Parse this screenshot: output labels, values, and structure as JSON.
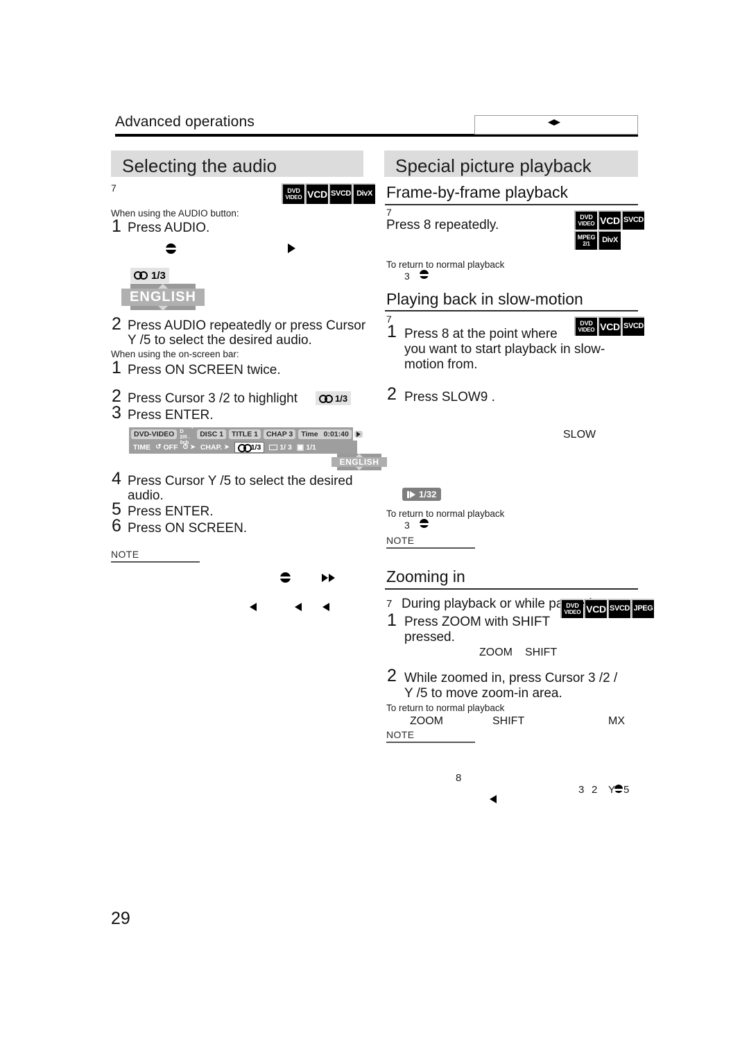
{
  "page": {
    "running_head": "Advanced operations",
    "page_number": "29",
    "header_box_icon": "diamond-marker-icon"
  },
  "left_column": {
    "section_title": "Selecting the audio",
    "format_badges": [
      {
        "line1": "DVD",
        "line2": "VIDEO"
      },
      {
        "line1": "VCD"
      },
      {
        "line1": "SVCD"
      },
      {
        "line1": "DivX"
      }
    ],
    "marker_7": "7",
    "intro_audio_button": "When using the AUDIO button:",
    "step1_num": "1",
    "step1_text": "Press AUDIO.",
    "osd": {
      "tag_value": "1/3",
      "tag_icon": "audio-channel-icon",
      "language": "ENGLISH"
    },
    "step2_num": "2",
    "step2_text_line1": "Press AUDIO repeatedly or press Cursor",
    "step2_text_line2": "Y /5  to select the desired audio.",
    "intro_onscreen_bar": "When using the on-screen bar:",
    "bar_step1_num": "1",
    "bar_step1_text": "Press ON SCREEN twice.",
    "bar_step2_num": "2",
    "bar_step2_text": "Press Cursor  3 /2  to highlight",
    "bar_step2_tag": "1/3",
    "bar_step3_num": "3",
    "bar_step3_text": "Press ENTER.",
    "onscreen_bar": {
      "disc_type": "DVD-VIDEO",
      "audio_format_line1": "Dolby D",
      "audio_format_line2": "2/0 . 0ch",
      "disc": "DISC 1",
      "title": "TITLE 1",
      "chapter": "CHAP  3",
      "time_label": "Time",
      "time_value": "0:01:40",
      "row2_time": "TIME",
      "row2_repeat": "OFF",
      "row2_clock": "",
      "row2_chap": "CHAP.",
      "row2_audio": "1/3",
      "row2_subtitle": "1/ 3",
      "row2_angle": "1/1",
      "popup_language": "ENGLISH"
    },
    "step4_num": "4",
    "step4_text_line1": "Press Cursor  Y /5  to select the desired",
    "step4_text_line2": "audio.",
    "step5_num": "5",
    "step5_text": "Press ENTER.",
    "step6_num": "6",
    "step6_text": "Press ON SCREEN.",
    "note_label": "NOTE"
  },
  "right_column": {
    "section_title": "Special picture playback",
    "frame_by_frame": {
      "heading": "Frame-by-frame playback",
      "marker_7": "7",
      "instruction": "Press  8  repeatedly.",
      "badges": [
        {
          "line1": "DVD",
          "line2": "VIDEO"
        },
        {
          "line1": "VCD"
        },
        {
          "line1": "SVCD"
        },
        {
          "line1": "MPEG",
          "line2": "2/1"
        },
        {
          "line1": "DivX"
        }
      ],
      "return_label": "To return to normal playback",
      "return_step": "3"
    },
    "slow_motion": {
      "heading": "Playing back in slow-motion",
      "marker_7": "7",
      "badges": [
        {
          "line1": "DVD",
          "line2": "VIDEO"
        },
        {
          "line1": "VCD"
        },
        {
          "line1": "SVCD"
        }
      ],
      "step1_num": "1",
      "step1_line1": "Press  8  at the point where",
      "step1_line2": "you want to start playback in slow-",
      "step1_line3": "motion from.",
      "step2_num": "2",
      "step2_text": "Press SLOW9 .",
      "slow_indicator": "SLOW",
      "speed_tag": "1/32",
      "return_label": "To return to normal playback",
      "return_step": "3",
      "note_label": "NOTE"
    },
    "zooming": {
      "heading": "Zooming in",
      "marker_7": "7",
      "intro": "During playback or while paused",
      "badges": [
        {
          "line1": "DVD",
          "line2": "VIDEO"
        },
        {
          "line1": "VCD"
        },
        {
          "line1": "SVCD"
        },
        {
          "line1": "JPEG"
        }
      ],
      "step1_num": "1",
      "step1_line1": "Press ZOOM with SHIFT",
      "step1_line2": "pressed.",
      "key_zoom": "ZOOM",
      "key_shift": "SHIFT",
      "step2_num": "2",
      "step2_line1": "While zoomed in, press Cursor    3 /2 /",
      "step2_line2": "Y /5  to move zoom-in area.",
      "return_label": "To return to normal playback",
      "return_zoom": "ZOOM",
      "return_shift": "SHIFT",
      "return_mx": "MX",
      "note_label": "NOTE"
    }
  },
  "stray_marks": {
    "mark_8": "8",
    "mark_3": "3",
    "mark_2": "2",
    "mark_y5": "Y",
    "mark_5": "5"
  }
}
